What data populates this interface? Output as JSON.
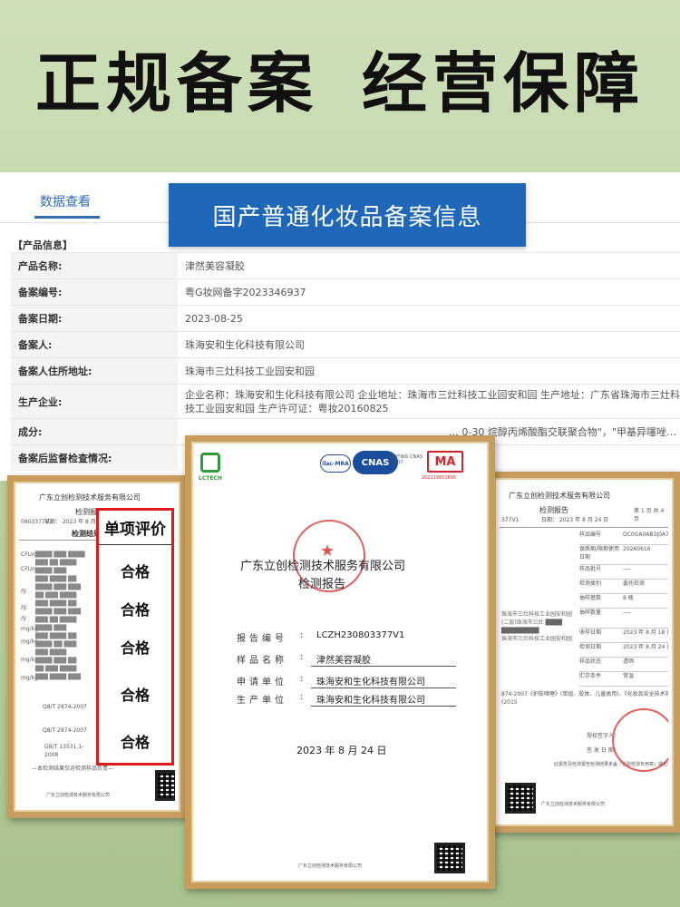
{
  "headline": {
    "left": "正规备案",
    "right": "经营保障"
  },
  "registry": {
    "tab": "数据查看",
    "banner": "国产普通化妆品备案信息",
    "section": "【产品信息】",
    "rows": [
      {
        "label": "产品名称:",
        "value": "津然美容凝胶"
      },
      {
        "label": "备案编号:",
        "value": "粤G妆网备字2023346937"
      },
      {
        "label": "备案日期:",
        "value": "2023-08-25"
      },
      {
        "label": "备案人:",
        "value": "珠海安和生化科技有限公司"
      },
      {
        "label": "备案人住所地址:",
        "value": "珠海市三灶科技工业园安和园"
      },
      {
        "label": "生产企业:",
        "value": "企业名称：珠海安和生化科技有限公司 企业地址：珠海市三灶科技工业园安和园 生产地址：广东省珠海市三灶科技工业园安和园 生产许可证：粤妆20160825"
      },
      {
        "label": "成分:",
        "value": "… 0-30 烷醇丙烯酸酯交联聚合物\"，\"甲基异噻唑…"
      },
      {
        "label": "备案后监督检查情况:",
        "value": ""
      }
    ]
  },
  "left_cert": {
    "company": "广东立创检测技术服务有限公司",
    "title": "检测报告",
    "report_no": "0803377V1",
    "date_line": "日期： 2023 年 8 月 24",
    "section": "检测结果",
    "left_col": [
      "CFU/g",
      "CFU/g",
      "/g",
      "/g",
      "/g",
      "mg/kg",
      "mg/kg",
      "mg/kg",
      "mg/kg"
    ],
    "standards": [
      "Q8/T 2874-2007",
      "Q8/T 2874-2007",
      "GB/T 13531.1-2008"
    ],
    "footnote": "—本检测结果仅对检测样品负责—",
    "footer": "广东立创检测技术服务有限公司"
  },
  "evaluation": {
    "title": "单项评价",
    "items": [
      "合格",
      "合格",
      "合格",
      "合格",
      "合格"
    ]
  },
  "center_cert": {
    "logo_text": "LCTECH",
    "cnas": "CNAS",
    "cnas_sub": "TESTING CNAS L3337",
    "ilac": "ilac-MRA",
    "cma": "MA",
    "cma_no": "202119001605",
    "company": "广东立创检测技术服务有限公司",
    "title": "检测报告",
    "fields": [
      {
        "label": "报告编号",
        "value": "LCZH230803377V1"
      },
      {
        "label": "样品名称",
        "value": "津然美容凝胶"
      },
      {
        "label": "申请单位",
        "value": "珠海安和生化科技有限公司"
      },
      {
        "label": "生产单位",
        "value": "珠海安和生化科技有限公司"
      }
    ],
    "date": "2023 年 8 月 24 日",
    "footer": "广东立创检测技术服务有限公司"
  },
  "right_cert": {
    "company": "广东立创检测技术服务有限公司",
    "title": "检测报告",
    "page": "第 1 页 共 4 页",
    "report_no": "377V1",
    "date_line": "日期： 2023 年 8 月 24 日",
    "rows": [
      {
        "k": "样品编号",
        "v": "OC0GA0AB3J0A7A"
      },
      {
        "k": "保质期/限期使用日期",
        "v": "20260616"
      },
      {
        "k": "样品批号",
        "v": "----"
      },
      {
        "k": "检测类别",
        "v": "委托检测"
      },
      {
        "k": "抽样基数",
        "v": "8 瓶"
      },
      {
        "k": "抽样数量",
        "v": "----"
      },
      {
        "k": "收样日期",
        "v": "2023 年 8 月 18 日"
      },
      {
        "k": "检测日期",
        "v": "2023 年 8 月 24 日"
      },
      {
        "k": "样品状态",
        "v": "透明"
      },
      {
        "k": "贮存条件",
        "v": "常温"
      }
    ],
    "standard_text": "874-2007《护肤啫喱》(单组、胶体、儿童类用)、《化妆品安全技术规范》(2015",
    "signer_lines": [
      "授权签字人：",
      "签 发 日 期："
    ],
    "note": "此报告及检测报告检测结果未盖「检验检测专用章」或无效。",
    "footer": "广东立创检测技术服务有限公司"
  }
}
